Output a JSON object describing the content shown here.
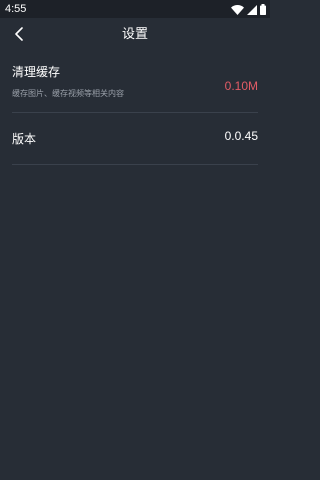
{
  "status_bar": {
    "time": "4:55",
    "icons": [
      "wifi-icon",
      "signal-icon",
      "battery-icon"
    ]
  },
  "header": {
    "title": "设置",
    "back_icon": "back-arrow-icon"
  },
  "settings": {
    "clear_cache": {
      "title": "清理缓存",
      "description": "缓存图片、缓存视频等相关内容",
      "value": "0.10M",
      "value_color": "#e25c66"
    },
    "version": {
      "title": "版本",
      "value": "0.0.45"
    }
  },
  "colors": {
    "background": "#272d36",
    "status_bar": "#1d2128",
    "divider": "#3a414c",
    "accent": "#e25c66"
  }
}
